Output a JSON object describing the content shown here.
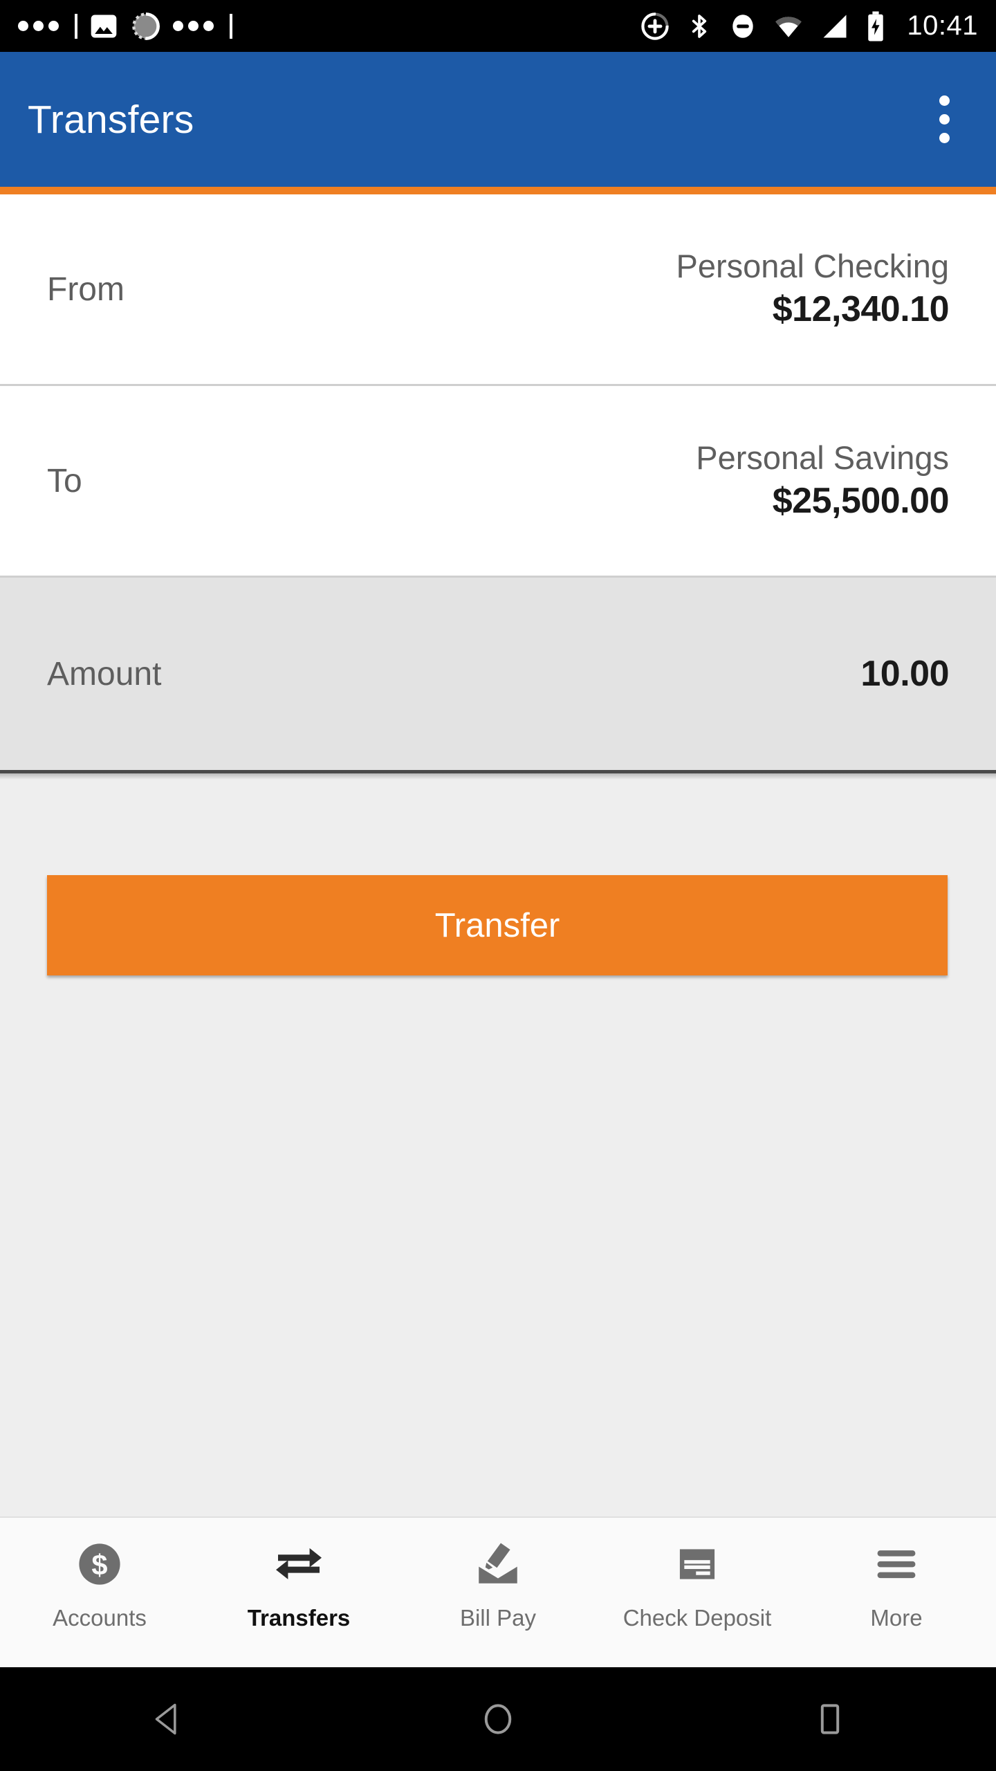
{
  "status_bar": {
    "time": "10:41",
    "left_icons": [
      "dots-indicator",
      "image-icon",
      "sync-progress-icon",
      "dots-indicator"
    ],
    "right_icons": [
      "location-add-icon",
      "bluetooth-icon",
      "do-not-disturb-icon",
      "wifi-icon",
      "cellular-signal-icon",
      "battery-charging-icon"
    ]
  },
  "app_bar": {
    "title": "Transfers",
    "overflow_icon": "more-vertical-icon",
    "background_color": "#1d5aa7",
    "accent_color": "#ef7f22"
  },
  "form": {
    "rows": [
      {
        "label": "From",
        "account": "Personal Checking",
        "balance": "$12,340.10"
      },
      {
        "label": "To",
        "account": "Personal Savings",
        "balance": "$25,500.00"
      }
    ],
    "amount": {
      "label": "Amount",
      "value": "10.00"
    },
    "submit": {
      "label": "Transfer",
      "color": "#ef7f22"
    }
  },
  "tab_bar": {
    "items": [
      {
        "label": "Accounts",
        "icon": "dollar-circle-icon",
        "active": false
      },
      {
        "label": "Transfers",
        "icon": "transfer-arrows-icon",
        "active": true
      },
      {
        "label": "Bill Pay",
        "icon": "envelope-pen-icon",
        "active": false
      },
      {
        "label": "Check Deposit",
        "icon": "check-document-icon",
        "active": false
      },
      {
        "label": "More",
        "icon": "hamburger-menu-icon",
        "active": false
      }
    ]
  },
  "system_nav": {
    "buttons": [
      "back-triangle-icon",
      "home-circle-icon",
      "recents-square-icon"
    ]
  }
}
